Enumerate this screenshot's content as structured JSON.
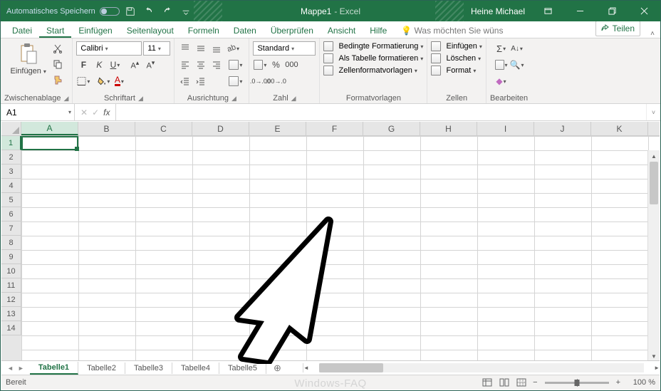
{
  "titlebar": {
    "autosave_label": "Automatisches Speichern",
    "document_name": "Mappe1",
    "app_suffix": "  -  Excel",
    "user_name": "Heine Michael"
  },
  "ribbon_tabs": {
    "items": [
      "Datei",
      "Start",
      "Einfügen",
      "Seitenlayout",
      "Formeln",
      "Daten",
      "Überprüfen",
      "Ansicht",
      "Hilfe",
      "Was möchten Sie wüns"
    ],
    "active_index": 1,
    "share_label": "Teilen"
  },
  "ribbon": {
    "clipboard": {
      "paste_label": "Einfügen",
      "title": "Zwischenablage"
    },
    "font": {
      "name": "Calibri",
      "size": "11",
      "title": "Schriftart"
    },
    "alignment": {
      "wrap_label": "ab",
      "merge_label": "",
      "title": "Ausrichtung"
    },
    "number": {
      "format": "Standard",
      "title": "Zahl"
    },
    "styles": {
      "cond": "Bedingte Formatierung",
      "table": "Als Tabelle formatieren",
      "cell": "Zellenformatvorlagen",
      "title": "Formatvorlagen"
    },
    "cells": {
      "insert": "Einfügen",
      "delete": "Löschen",
      "format": "Format",
      "title": "Zellen"
    },
    "editing": {
      "title": "Bearbeiten"
    }
  },
  "formula": {
    "namebox": "A1",
    "value": ""
  },
  "grid": {
    "columns": [
      "A",
      "B",
      "C",
      "D",
      "E",
      "F",
      "G",
      "H",
      "I",
      "J",
      "K"
    ],
    "rows": [
      "1",
      "2",
      "3",
      "4",
      "5",
      "6",
      "7",
      "8",
      "9",
      "10",
      "11",
      "12",
      "13",
      "14"
    ],
    "active_col": 0,
    "active_row": 0
  },
  "sheets": {
    "tabs": [
      "Tabelle1",
      "Tabelle2",
      "Tabelle3",
      "Tabelle4",
      "Tabelle5"
    ],
    "active_index": 0
  },
  "status": {
    "ready": "Bereit",
    "zoom": "100 %"
  },
  "zoom": {
    "minus": "−",
    "plus": "+"
  }
}
